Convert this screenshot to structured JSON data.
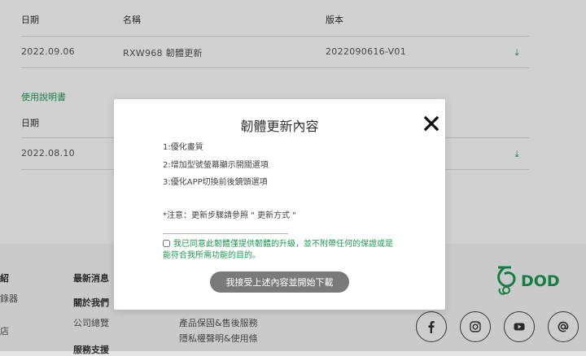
{
  "firmware_table": {
    "headers": {
      "date": "日期",
      "name": "名稱",
      "version": "版本"
    },
    "row": {
      "date": "2022.09.06",
      "name": "RXW968 韌體更新",
      "version": "2022090616-V01"
    }
  },
  "manual_section": {
    "title": "使用說明書",
    "header_date": "日期",
    "row": {
      "date": "2022.08.10"
    }
  },
  "footer": {
    "col1_head": "紹",
    "col1_item1": "錄器",
    "col1_item2": "店",
    "col2_head": "最新消息",
    "col2_item1": "關於我們",
    "col2_item2": "公司總覽",
    "col2_item3": "服務支援",
    "col3_item1": "產品保固&售後服務",
    "col3_item2": "隱私權聲明&使用條",
    "logo_text": "DOD",
    "socials": [
      "facebook-icon",
      "instagram-icon",
      "youtube-icon",
      "email-icon"
    ]
  },
  "modal": {
    "title": "韌體更新內容",
    "items": [
      "1:優化畫質",
      "2:增加型號螢幕顯示開關選項",
      "3:優化APP切換前後鏡頭選項"
    ],
    "note": "*注意：更新步驟請參照 \" 更新方式 \"",
    "agree_text": "我已同意此韌體僅提供韌體的升級，並不附帶任何的保證或是能符合我所需功能的目的。",
    "button_label": "我接受上述內容並開始下載"
  },
  "colors": {
    "accent": "#1a9a52",
    "button": "#7a7a7a"
  }
}
